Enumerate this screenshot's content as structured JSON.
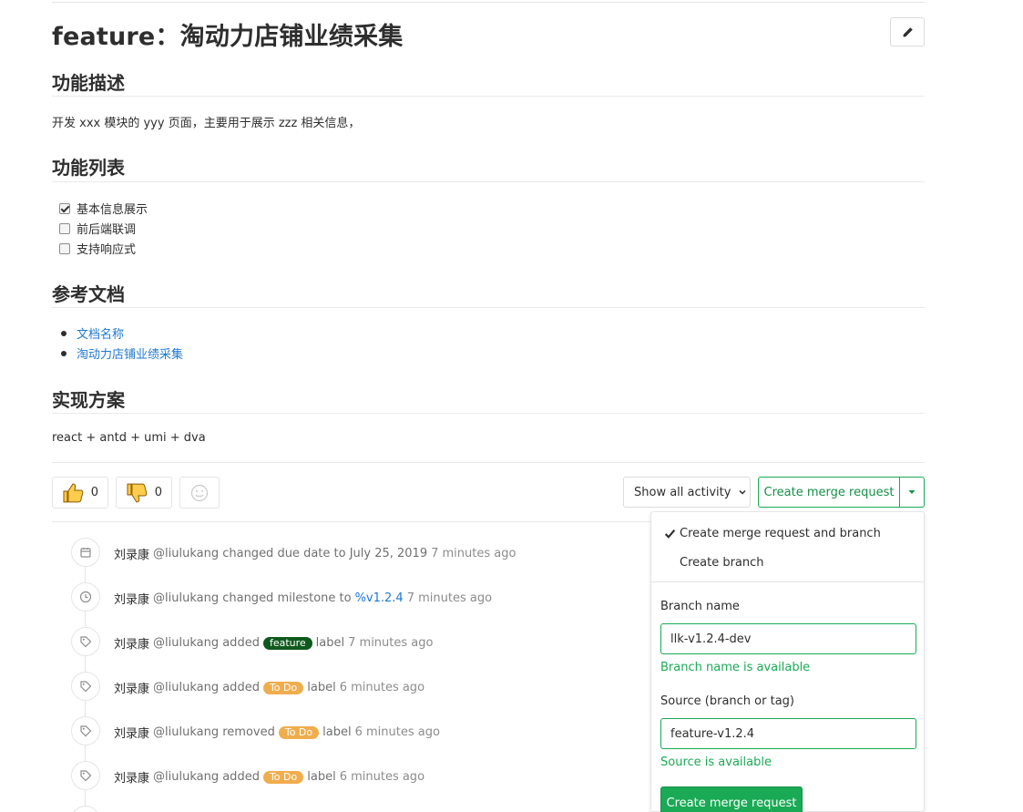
{
  "issue": {
    "title": "feature：淘动力店铺业绩采集"
  },
  "description": {
    "features_heading": "功能描述",
    "features_text": "开发 xxx 模块的 yyy 页面，主要用于展示 zzz 相关信息，",
    "list_heading": "功能列表",
    "tasks": [
      {
        "label": "基本信息展示",
        "checked": true
      },
      {
        "label": "前后端联调",
        "checked": false
      },
      {
        "label": "支持响应式",
        "checked": false
      }
    ],
    "docs_heading": "参考文档",
    "docs": [
      "文档名称",
      "淘动力店铺业绩采集"
    ],
    "impl_heading": "实现方案",
    "impl_text": "react + antd + umi + dva"
  },
  "awards": {
    "thumbs_up_count": "0",
    "thumbs_down_count": "0"
  },
  "actions": {
    "activity_filter": "Show all activity",
    "create_mr": "Create merge request"
  },
  "timeline": [
    {
      "author": "刘录康",
      "pre": "@liulukang changed due date to July 25, 2019",
      "time": "7 minutes ago",
      "icon": "calendar-icon"
    },
    {
      "author": "刘录康",
      "pre": "@liulukang changed milestone to",
      "link": "%v1.2.4",
      "time": "7 minutes ago",
      "icon": "clock-icon"
    },
    {
      "author": "刘录康",
      "pre": "@liulukang added",
      "badge": "feature",
      "post": "label",
      "time": "7 minutes ago",
      "icon": "tag-icon"
    },
    {
      "author": "刘录康",
      "pre": "@liulukang added",
      "badge": "To Do",
      "post": "label",
      "time": "6 minutes ago",
      "icon": "tag-icon"
    },
    {
      "author": "刘录康",
      "pre": "@liulukang removed",
      "badge": "To Do",
      "post": "label",
      "time": "6 minutes ago",
      "icon": "tag-icon"
    },
    {
      "author": "刘录康",
      "pre": "@liulukang added",
      "badge": "To Do",
      "post": "label",
      "time": "6 minutes ago",
      "icon": "tag-icon"
    }
  ],
  "colors": {
    "feature_badge": "#0e5a1d",
    "todo_badge": "#f0ad4e",
    "accent_green": "#1aaa55",
    "link_blue": "#1f78d1"
  },
  "dropdown": {
    "option_mr_branch": "Create merge request and branch",
    "option_branch": "Create branch",
    "branch_label": "Branch name",
    "branch_value": "llk-v1.2.4-dev",
    "branch_ok": "Branch name is available",
    "source_label": "Source (branch or tag)",
    "source_value": "feature-v1.2.4",
    "source_ok": "Source is available",
    "submit": "Create merge request"
  }
}
